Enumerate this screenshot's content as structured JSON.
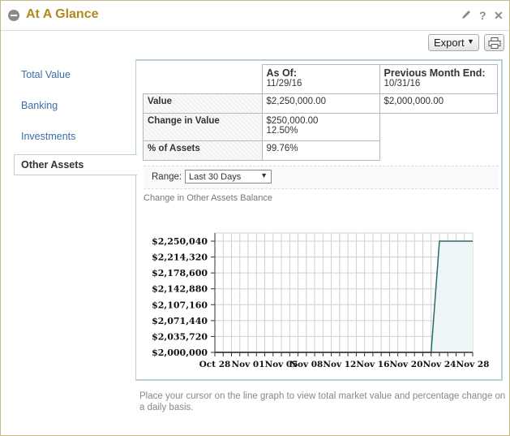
{
  "header": {
    "title": "At A Glance"
  },
  "toolbar": {
    "edit_icon": "pencil-icon",
    "help_label": "?",
    "close_label": "✕",
    "export_label": "Export",
    "print_icon": "printer-icon"
  },
  "sidebar": {
    "items": [
      {
        "label": "Total Value"
      },
      {
        "label": "Banking"
      },
      {
        "label": "Investments"
      },
      {
        "label": "Other Assets",
        "active": true
      }
    ]
  },
  "summary": {
    "as_of_label": "As Of:",
    "as_of_date": "11/29/16",
    "prev_label": "Previous Month End:",
    "prev_date": "10/31/16",
    "rows": [
      {
        "label": "Value",
        "current": "$2,250,000.00",
        "previous": "$2,000,000.00"
      },
      {
        "label": "Change in Value",
        "current": "$250,000.00",
        "current_pct": "12.50%"
      },
      {
        "label": "% of Assets",
        "current": "99.76%"
      }
    ]
  },
  "range": {
    "label": "Range:",
    "selected": "Last 30 Days"
  },
  "chart_data": {
    "type": "area",
    "title": "Change in Other Assets Balance",
    "x": [
      "Oct 28",
      "Oct 29",
      "Oct 30",
      "Oct 31",
      "Nov 01",
      "Nov 02",
      "Nov 03",
      "Nov 04",
      "Nov 05",
      "Nov 06",
      "Nov 07",
      "Nov 08",
      "Nov 09",
      "Nov 10",
      "Nov 11",
      "Nov 12",
      "Nov 13",
      "Nov 14",
      "Nov 15",
      "Nov 16",
      "Nov 17",
      "Nov 18",
      "Nov 19",
      "Nov 20",
      "Nov 21",
      "Nov 22",
      "Nov 23",
      "Nov 24",
      "Nov 25",
      "Nov 26",
      "Nov 27",
      "Nov 28"
    ],
    "values": [
      2000000,
      2000000,
      2000000,
      2000000,
      2000000,
      2000000,
      2000000,
      2000000,
      2000000,
      2000000,
      2000000,
      2000000,
      2000000,
      2000000,
      2000000,
      2000000,
      2000000,
      2000000,
      2000000,
      2000000,
      2000000,
      2000000,
      2000000,
      2000000,
      2000000,
      2000000,
      2000000,
      2250000,
      2250000,
      2250000,
      2250000,
      2250000
    ],
    "x_tick_labels": [
      "Oct 28",
      "Nov 01",
      "Nov 05",
      "Nov 08",
      "Nov 12",
      "Nov 16",
      "Nov 20",
      "Nov 24",
      "Nov 28"
    ],
    "y_tick_labels": [
      "$2,250,040",
      "$2,214,320",
      "$2,178,600",
      "$2,142,880",
      "$2,107,160",
      "$2,071,440",
      "$2,035,720",
      "$2,000,000"
    ],
    "ylim": [
      2000000,
      2250040
    ],
    "grid": true,
    "line_color": "#2a6b6b",
    "fill_color": "#eef5f7"
  },
  "footer_note": "Place your cursor on the line graph to view total market value and percentage change on a daily basis."
}
